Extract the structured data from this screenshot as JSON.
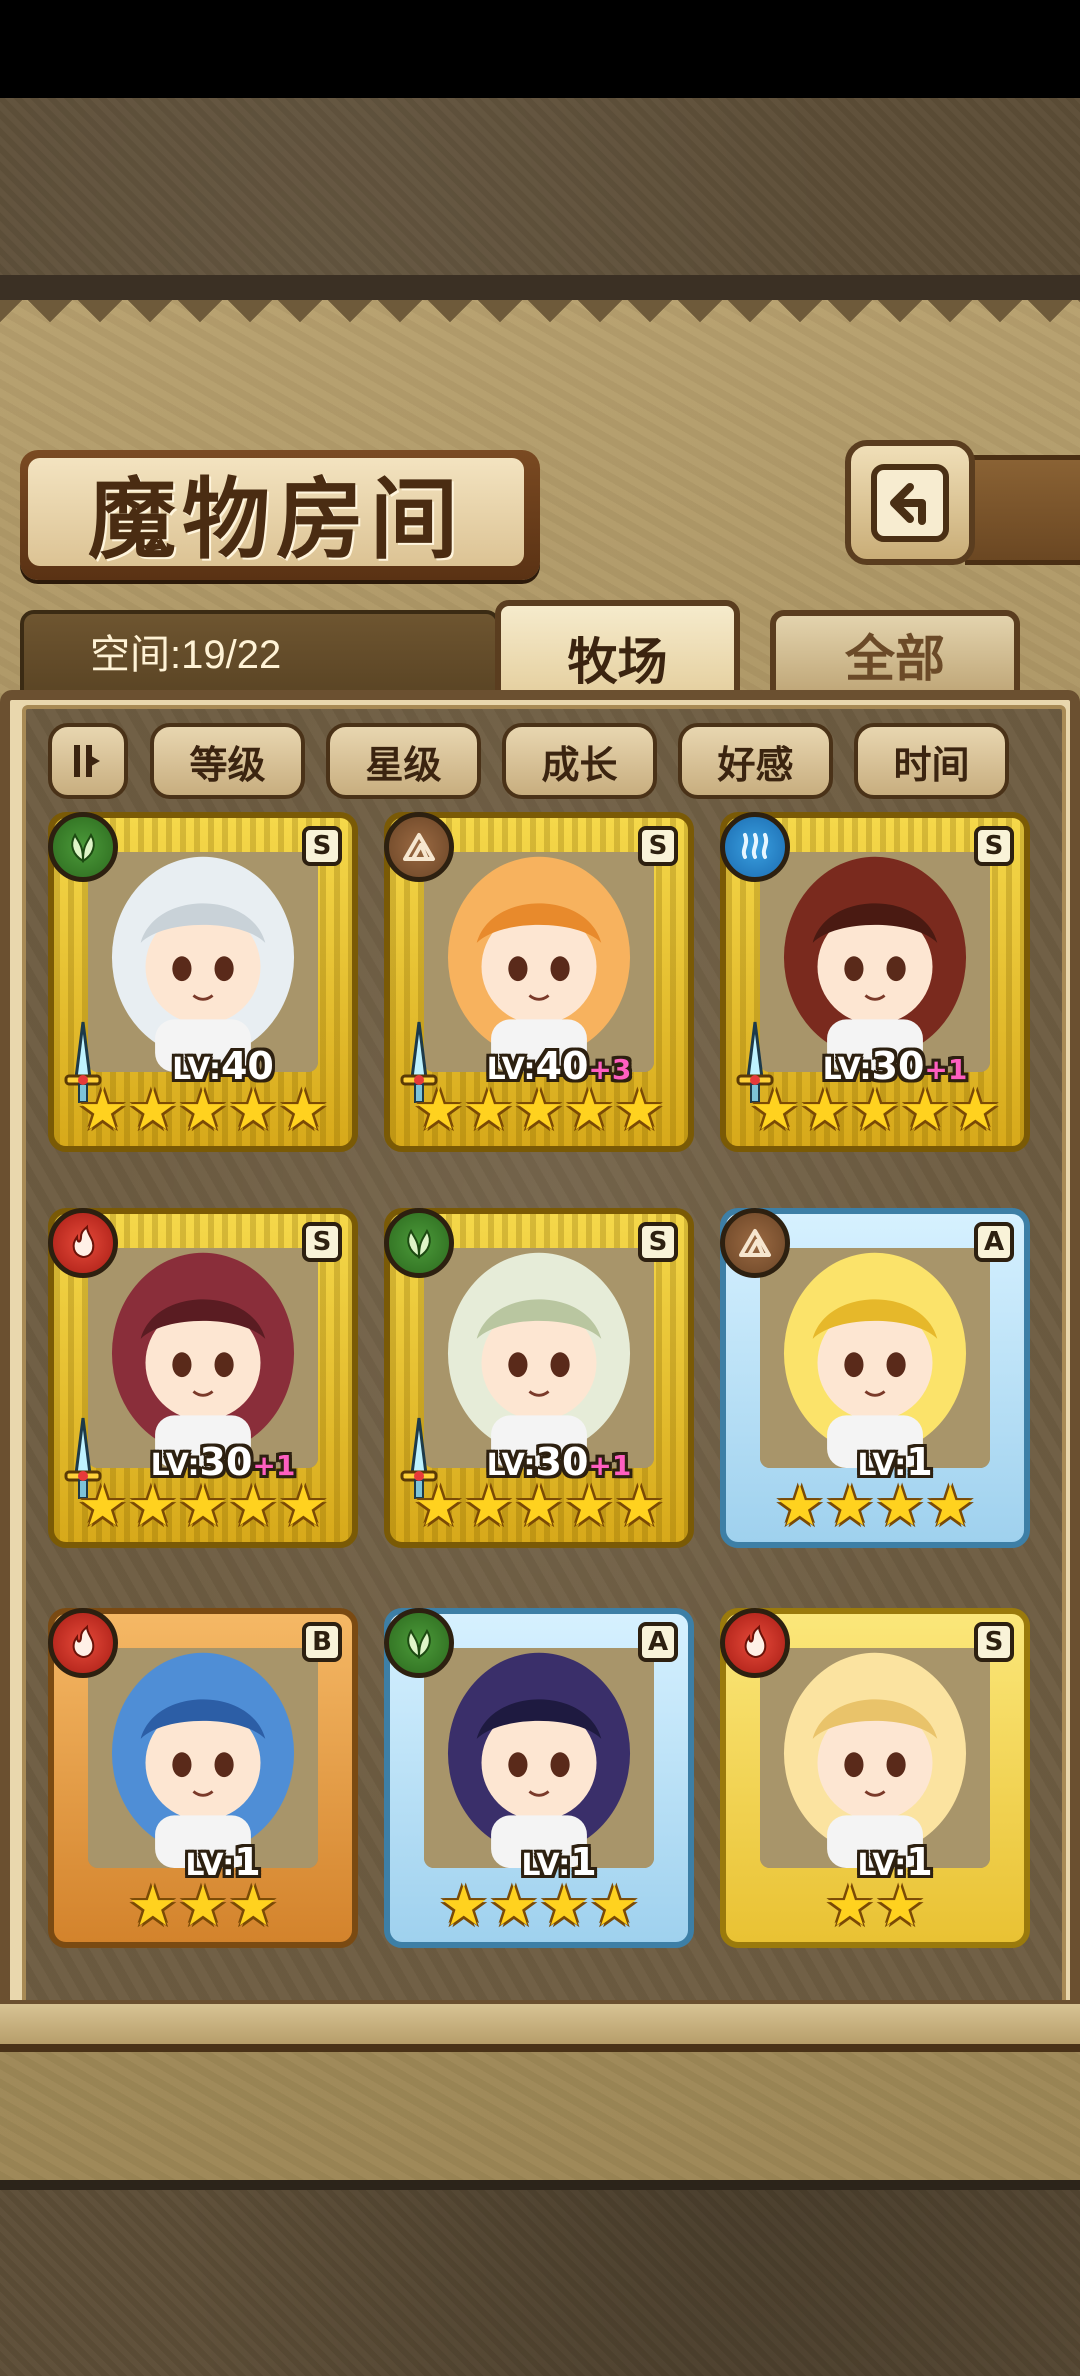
{
  "header": {
    "title": "魔物房间",
    "back_icon": "return-arrow-icon"
  },
  "info": {
    "space_label": "空间:19/22"
  },
  "tabs": [
    {
      "label": "牧场",
      "selected": true
    },
    {
      "label": "全部",
      "selected": false
    }
  ],
  "sort": {
    "toggle_icon": "sort-order-icon",
    "buttons": [
      "等级",
      "星级",
      "成长",
      "好感",
      "时间"
    ]
  },
  "cards": [
    {
      "element": "nature",
      "rank": "S",
      "level_prefix": "LV:",
      "level": "40",
      "bonus": "",
      "stars": "★★★★★",
      "has_weapon": true
    },
    {
      "element": "earth",
      "rank": "S",
      "level_prefix": "LV:",
      "level": "40",
      "bonus": "+3",
      "stars": "★★★★★",
      "has_weapon": true
    },
    {
      "element": "water",
      "rank": "S",
      "level_prefix": "LV:",
      "level": "30",
      "bonus": "+1",
      "stars": "★★★★★",
      "has_weapon": true
    },
    {
      "element": "fire",
      "rank": "S",
      "level_prefix": "LV:",
      "level": "30",
      "bonus": "+1",
      "stars": "★★★★★",
      "has_weapon": true
    },
    {
      "element": "nature",
      "rank": "S",
      "level_prefix": "LV:",
      "level": "30",
      "bonus": "+1",
      "stars": "★★★★★",
      "has_weapon": true
    },
    {
      "element": "earth",
      "rank": "A",
      "level_prefix": "LV:",
      "level": "1",
      "bonus": "",
      "stars": "★★★★",
      "has_weapon": false
    },
    {
      "element": "fire",
      "rank": "B",
      "level_prefix": "LV:",
      "level": "1",
      "bonus": "",
      "stars": "★★★",
      "has_weapon": false
    },
    {
      "element": "nature",
      "rank": "A",
      "level_prefix": "LV:",
      "level": "1",
      "bonus": "",
      "stars": "★★★★",
      "has_weapon": false
    },
    {
      "element": "fire",
      "rank": "S",
      "level_prefix": "LV:",
      "level": "1",
      "bonus": "",
      "stars": "★★",
      "has_weapon": false
    }
  ]
}
